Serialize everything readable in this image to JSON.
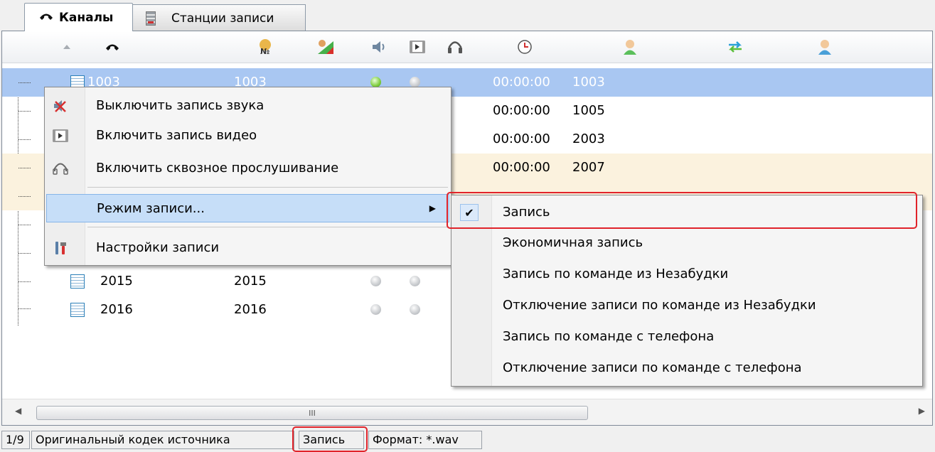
{
  "tabs": [
    {
      "label": "Каналы",
      "icon": "phone-handset-icon",
      "active": true
    },
    {
      "label": "Станции записи",
      "icon": "server-icon",
      "active": false
    }
  ],
  "columns": [
    {
      "icon": "sort-ascending-icon"
    },
    {
      "icon": "phone-handset-icon"
    },
    {
      "icon": "number-icon"
    },
    {
      "icon": "signal-level-icon"
    },
    {
      "icon": "speaker-icon"
    },
    {
      "icon": "video-icon"
    },
    {
      "icon": "headphones-icon"
    },
    {
      "icon": "clock-icon"
    },
    {
      "icon": "user-icon"
    },
    {
      "icon": "transfer-arrows-icon"
    },
    {
      "icon": "user-icon"
    }
  ],
  "rows": [
    {
      "name": "1003",
      "number": "1003",
      "time": "00:00:00",
      "peer": "1003"
    },
    {
      "name": "",
      "number": "",
      "time": "00:00:00",
      "peer": "1005"
    },
    {
      "name": "",
      "number": "",
      "time": "00:00:00",
      "peer": "2003"
    },
    {
      "name": "",
      "number": "",
      "time": "00:00:00",
      "peer": "2007"
    },
    {
      "name": "",
      "number": "",
      "time": "",
      "peer": ""
    },
    {
      "name": "",
      "number": "",
      "time": "",
      "peer": ""
    },
    {
      "name": "",
      "number": "",
      "time": "",
      "peer": ""
    },
    {
      "name": "2015",
      "number": "2015",
      "time": "",
      "peer": ""
    },
    {
      "name": "2016",
      "number": "2016",
      "time": "",
      "peer": ""
    }
  ],
  "context_menu": {
    "items": [
      {
        "label": "Выключить запись звука",
        "icon": "speaker-muted-icon"
      },
      {
        "label": "Включить запись видео",
        "icon": "video-icon"
      },
      {
        "label": "Включить сквозное прослушивание",
        "icon": "headphones-icon"
      },
      {
        "label": "Режим записи...",
        "icon": ""
      },
      {
        "label": "Настройки записи",
        "icon": "tools-icon"
      }
    ]
  },
  "submenu": {
    "items": [
      {
        "label": "Запись",
        "checked": true
      },
      {
        "label": "Экономичная запись",
        "checked": false
      },
      {
        "label": "Запись по команде из Незабудки",
        "checked": false
      },
      {
        "label": "Отключение записи по команде из Незабудки",
        "checked": false
      },
      {
        "label": "Запись по команде с телефона",
        "checked": false
      },
      {
        "label": "Отключение записи по команде с телефона",
        "checked": false
      }
    ]
  },
  "scrollbar": {
    "grip": "III"
  },
  "statusbar": {
    "page": "1/9",
    "codec": "Оригинальный кодек источника",
    "mode": "Запись",
    "format": "Формат: *.wav"
  },
  "colors": {
    "selection": "#a9c7f2",
    "highlight": "#e0232a",
    "menu_highlight": "#c6def8"
  }
}
